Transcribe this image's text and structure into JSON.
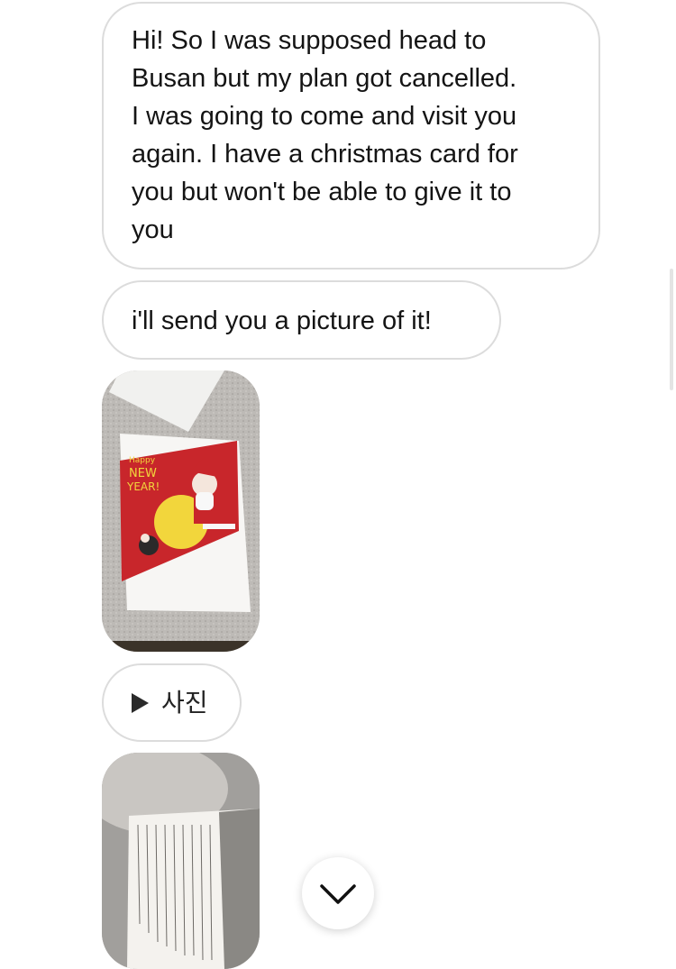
{
  "messages": [
    {
      "type": "text",
      "lines": [
        "Hi! So I was supposed head to",
        "Busan but my plan got cancelled.",
        "I was going to come and visit you",
        "again. I have a christmas card for",
        "you but won't be able to give it to",
        "you"
      ]
    },
    {
      "type": "text",
      "text": "i'll send you a picture of it!"
    },
    {
      "type": "image",
      "card_text": [
        "Happy",
        "NEW",
        "YEAR!"
      ]
    },
    {
      "type": "attachment",
      "label": "사진",
      "icon": "play-icon"
    },
    {
      "type": "image",
      "description_icon": "handwritten-card-photo"
    }
  ],
  "controls": {
    "scroll_down_icon": "chevron-down-icon"
  },
  "colors": {
    "bubble_border": "#dcdcdc",
    "card_red": "#c8262b",
    "card_yellow": "#f2d63c",
    "photo_background": "#b8b6b3"
  }
}
